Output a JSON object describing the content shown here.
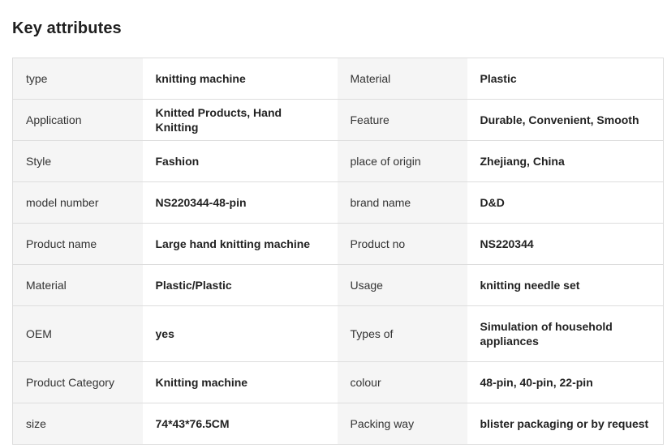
{
  "title": "Key attributes",
  "rows": [
    {
      "k1": "type",
      "v1": "knitting machine",
      "k2": "Material",
      "v2": "Plastic"
    },
    {
      "k1": "Application",
      "v1": "Knitted Products, Hand Knitting",
      "k2": "Feature",
      "v2": "Durable, Convenient, Smooth"
    },
    {
      "k1": "Style",
      "v1": "Fashion",
      "k2": "place of origin",
      "v2": "Zhejiang, China"
    },
    {
      "k1": "model number",
      "v1": "NS220344-48-pin",
      "k2": "brand name",
      "v2": "D&D"
    },
    {
      "k1": "Product name",
      "v1": "Large hand knitting machine",
      "k2": "Product no",
      "v2": "NS220344"
    },
    {
      "k1": "Material",
      "v1": "Plastic/Plastic",
      "k2": "Usage",
      "v2": "knitting needle set"
    },
    {
      "k1": "OEM",
      "v1": "yes",
      "k2": "Types of",
      "v2": "Simulation of household appliances"
    },
    {
      "k1": "Product Category",
      "v1": "Knitting machine",
      "k2": "colour",
      "v2": "48-pin, 40-pin, 22-pin"
    },
    {
      "k1": "size",
      "v1": "74*43*76.5CM",
      "k2": "Packing way",
      "v2": "blister packaging or by request"
    }
  ]
}
